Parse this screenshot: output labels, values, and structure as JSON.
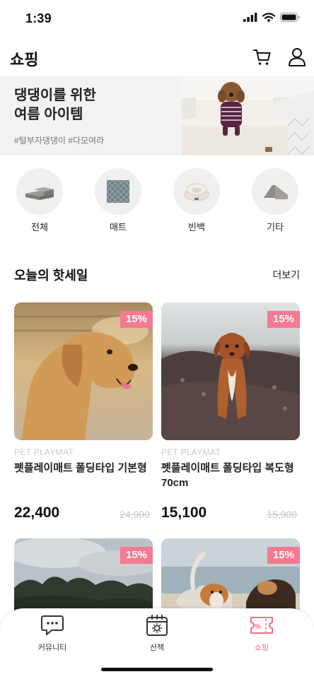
{
  "status_bar": {
    "time": "1:39"
  },
  "header": {
    "title": "쇼핑"
  },
  "banner": {
    "title_line1": "댕댕이를 위한",
    "title_line2": "여름 아이템",
    "tags": "#털부자댕댕이 #다모여라"
  },
  "categories": [
    {
      "label": "전체",
      "icon": "stair-ramp-icon"
    },
    {
      "label": "매트",
      "icon": "mat-icon"
    },
    {
      "label": "빈백",
      "icon": "beanbag-icon"
    },
    {
      "label": "기타",
      "icon": "slope-icon"
    }
  ],
  "hot_sale": {
    "title": "오늘의 핫세일",
    "more": "더보기",
    "products": [
      {
        "brand": "PET PLAYMAT",
        "name": "펫플레이매트 폴딩타입 기본형",
        "price": "22,400",
        "original_price": "24,900",
        "discount": "15%"
      },
      {
        "brand": "PET PLAYMAT",
        "name": "펫플레이매트 폴딩타입 복도형 70cm",
        "price": "15,100",
        "original_price": "15,900",
        "discount": "15%"
      },
      {
        "discount": "15%"
      },
      {
        "discount": "15%"
      }
    ]
  },
  "tabbar": {
    "items": [
      {
        "label": "커뮤니티",
        "icon": "chat-bubble-icon"
      },
      {
        "label": "산책",
        "icon": "calendar-sun-icon"
      },
      {
        "label": "쇼핑",
        "icon": "coupon-icon",
        "active": true
      }
    ]
  },
  "colors": {
    "accent": "#ee6f87",
    "badge": "#f37a91",
    "banner_bg": "#f2f2f2"
  }
}
